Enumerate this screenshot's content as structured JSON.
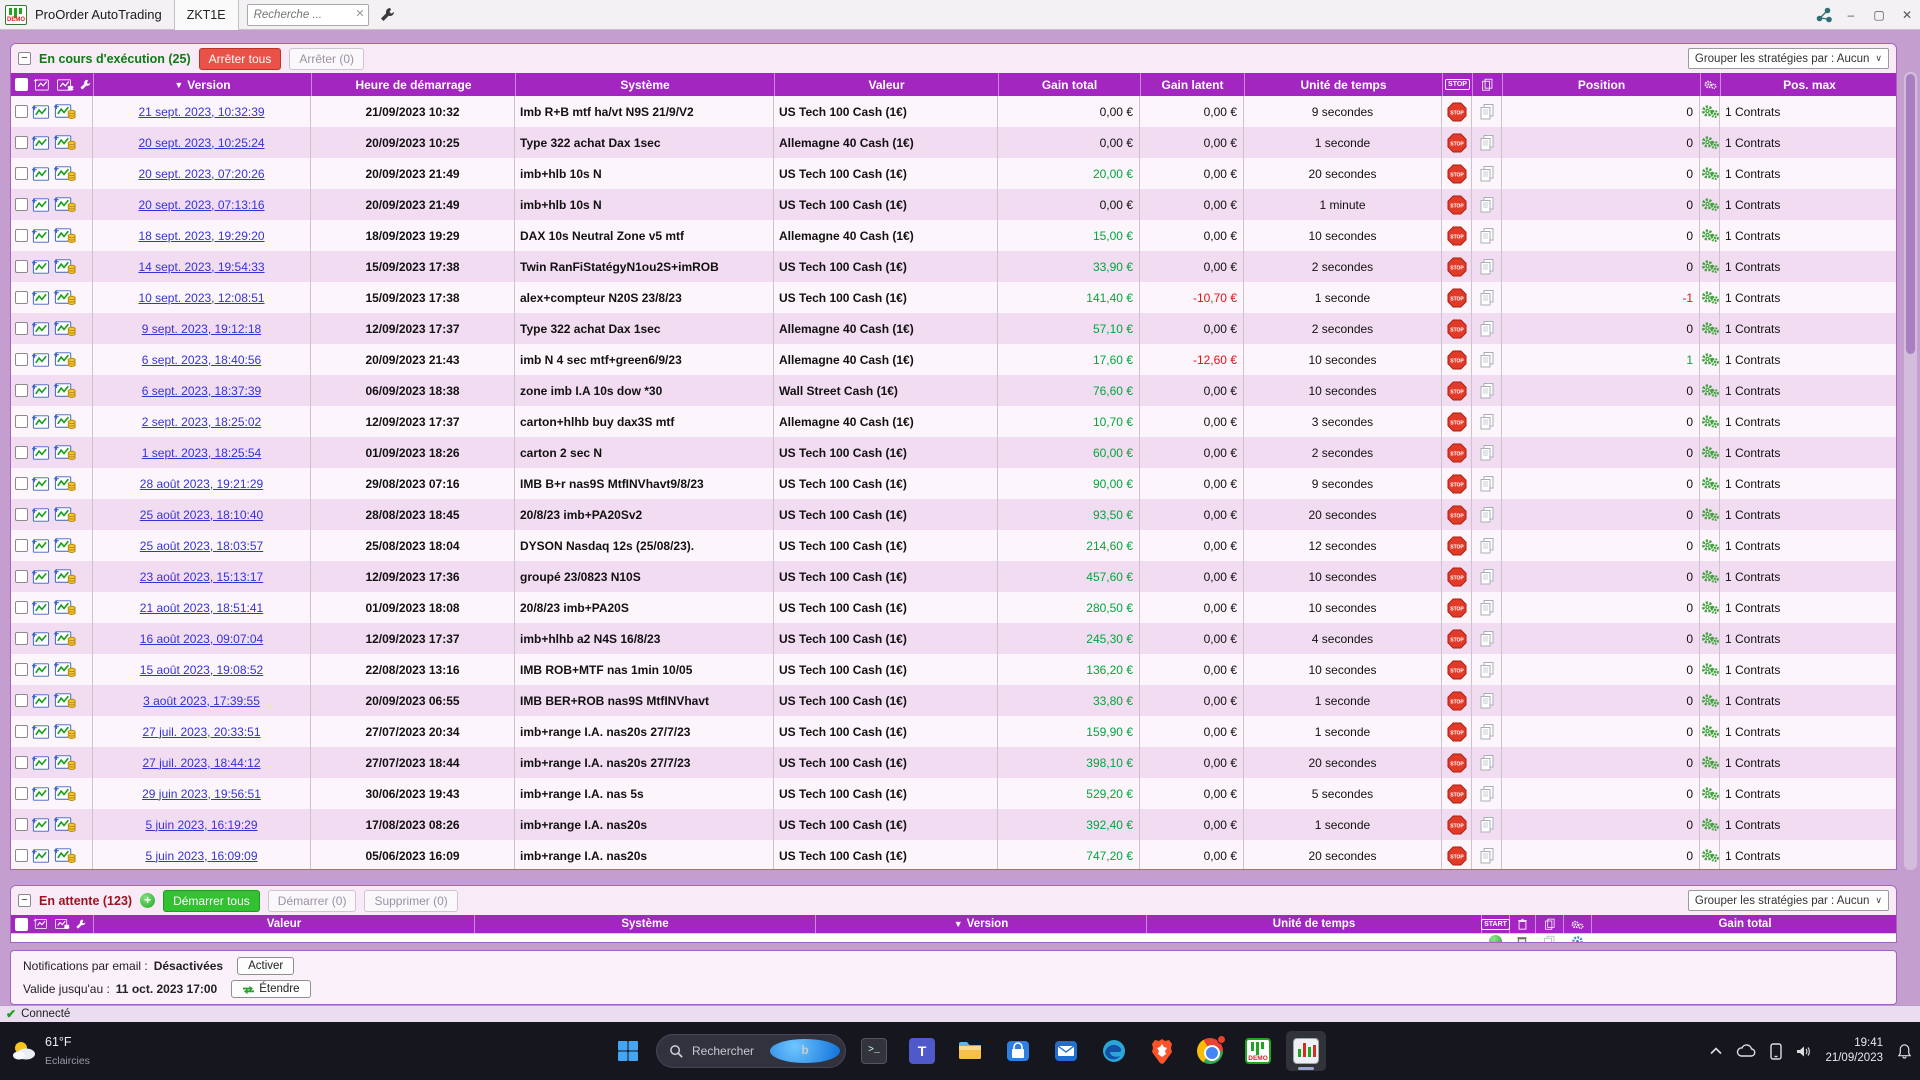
{
  "titlebar": {
    "app_title": "ProOrder AutoTrading",
    "demo_label": "DEMO",
    "tab": "ZKT1E",
    "search_placeholder": "Recherche ..."
  },
  "window_controls": {
    "minimize": "–",
    "maximize": "▢",
    "close": "✕"
  },
  "icons": {
    "collapse": "−",
    "plus": "+",
    "sort_desc": "▼",
    "dropdown_arrow": "∨",
    "clear_search": "✕",
    "check": "✔",
    "chevron_up": "^",
    "stop_badge": "STOP",
    "start_badge": "START"
  },
  "running": {
    "title": "En cours d'exécution (25)",
    "stop_all": "Arrêter tous",
    "stop_selected": "Arrêter (0)",
    "group_by": "Grouper les stratégies par : Aucun",
    "columns": {
      "version": "Version",
      "start": "Heure de démarrage",
      "system": "Système",
      "value": "Valeur",
      "gain": "Gain total",
      "latent": "Gain latent",
      "unit": "Unité de temps",
      "position": "Position",
      "posmax": "Pos. max"
    },
    "rows": [
      {
        "version": "21 sept. 2023, 10:32:39",
        "start": "21/09/2023 10:32",
        "system": "Imb R+B mtf ha/vt N9S 21/9/V2",
        "value": "US Tech 100 Cash (1€)",
        "gain": "0,00 €",
        "latent": "0,00 €",
        "unit": "9 secondes",
        "pos": "0",
        "posmax": "1 Contrats"
      },
      {
        "version": "20 sept. 2023, 10:25:24",
        "start": "20/09/2023 10:25",
        "system": "Type 322 achat Dax 1sec",
        "value": "Allemagne 40 Cash (1€)",
        "gain": "0,00 €",
        "latent": "0,00 €",
        "unit": "1 seconde",
        "pos": "0",
        "posmax": "1 Contrats"
      },
      {
        "version": "20 sept. 2023, 07:20:26",
        "start": "20/09/2023 21:49",
        "system": "imb+hlb 10s N",
        "value": "US Tech 100 Cash (1€)",
        "gain": "20,00 €",
        "latent": "0,00 €",
        "unit": "20 secondes",
        "pos": "0",
        "posmax": "1 Contrats"
      },
      {
        "version": "20 sept. 2023, 07:13:16",
        "start": "20/09/2023 21:49",
        "system": "imb+hlb 10s N",
        "value": "US Tech 100 Cash (1€)",
        "gain": "0,00 €",
        "latent": "0,00 €",
        "unit": "1 minute",
        "pos": "0",
        "posmax": "1 Contrats"
      },
      {
        "version": "18 sept. 2023, 19:29:20",
        "start": "18/09/2023 19:29",
        "system": "DAX 10s Neutral Zone v5 mtf",
        "value": "Allemagne 40 Cash (1€)",
        "gain": "15,00 €",
        "latent": "0,00 €",
        "unit": "10 secondes",
        "pos": "0",
        "posmax": "1 Contrats"
      },
      {
        "version": "14 sept. 2023, 19:54:33",
        "start": "15/09/2023 17:38",
        "system": "Twin RanFiStatégyN1ou2S+imROB",
        "value": "US Tech 100 Cash (1€)",
        "gain": "33,90 €",
        "latent": "0,00 €",
        "unit": "2 secondes",
        "pos": "0",
        "posmax": "1 Contrats"
      },
      {
        "version": "10 sept. 2023, 12:08:51",
        "start": "15/09/2023 17:38",
        "system": "alex+compteur N20S 23/8/23",
        "value": "US Tech 100 Cash (1€)",
        "gain": "141,40 €",
        "latent": "-10,70 €",
        "unit": "1 seconde",
        "pos": "-1",
        "posmax": "1 Contrats"
      },
      {
        "version": "9 sept. 2023, 19:12:18",
        "start": "12/09/2023 17:37",
        "system": "Type 322 achat Dax 1sec",
        "value": "Allemagne 40 Cash (1€)",
        "gain": "57,10 €",
        "latent": "0,00 €",
        "unit": "2 secondes",
        "pos": "0",
        "posmax": "1 Contrats"
      },
      {
        "version": "6 sept. 2023, 18:40:56",
        "start": "20/09/2023 21:43",
        "system": "imb N 4 sec mtf+green6/9/23",
        "value": "Allemagne 40 Cash (1€)",
        "gain": "17,60 €",
        "latent": "-12,60 €",
        "unit": "10 secondes",
        "pos": "1",
        "posmax": "1 Contrats"
      },
      {
        "version": "6 sept. 2023, 18:37:39",
        "start": "06/09/2023 18:38",
        "system": "zone imb I.A 10s dow *30",
        "value": "Wall Street Cash (1€)",
        "gain": "76,60 €",
        "latent": "0,00 €",
        "unit": "10 secondes",
        "pos": "0",
        "posmax": "1 Contrats"
      },
      {
        "version": "2 sept. 2023, 18:25:02",
        "start": "12/09/2023 17:37",
        "system": "carton+hlhb buy dax3S mtf",
        "value": "Allemagne 40 Cash (1€)",
        "gain": "10,70 €",
        "latent": "0,00 €",
        "unit": "3 secondes",
        "pos": "0",
        "posmax": "1 Contrats"
      },
      {
        "version": "1 sept. 2023, 18:25:54",
        "start": "01/09/2023 18:26",
        "system": "carton 2 sec N",
        "value": "US Tech 100 Cash (1€)",
        "gain": "60,00 €",
        "latent": "0,00 €",
        "unit": "2 secondes",
        "pos": "0",
        "posmax": "1 Contrats"
      },
      {
        "version": "28 août 2023, 19:21:29",
        "start": "29/08/2023 07:16",
        "system": "IMB B+r nas9S MtfINVhavt9/8/23",
        "value": "US Tech 100 Cash (1€)",
        "gain": "90,00 €",
        "latent": "0,00 €",
        "unit": "9 secondes",
        "pos": "0",
        "posmax": "1 Contrats"
      },
      {
        "version": "25 août 2023, 18:10:40",
        "start": "28/08/2023 18:45",
        "system": "20/8/23 imb+PA20Sv2",
        "value": "US Tech 100 Cash (1€)",
        "gain": "93,50 €",
        "latent": "0,00 €",
        "unit": "20 secondes",
        "pos": "0",
        "posmax": "1 Contrats"
      },
      {
        "version": "25 août 2023, 18:03:57",
        "start": "25/08/2023 18:04",
        "system": "DYSON Nasdaq 12s (25/08/23).",
        "value": "US Tech 100 Cash (1€)",
        "gain": "214,60 €",
        "latent": "0,00 €",
        "unit": "12 secondes",
        "pos": "0",
        "posmax": "1 Contrats"
      },
      {
        "version": "23 août 2023, 15:13:17",
        "start": "12/09/2023 17:36",
        "system": "groupé 23/0823 N10S",
        "value": "US Tech 100 Cash (1€)",
        "gain": "457,60 €",
        "latent": "0,00 €",
        "unit": "10 secondes",
        "pos": "0",
        "posmax": "1 Contrats"
      },
      {
        "version": "21 août 2023, 18:51:41",
        "start": "01/09/2023 18:08",
        "system": "20/8/23 imb+PA20S",
        "value": "US Tech 100 Cash (1€)",
        "gain": "280,50 €",
        "latent": "0,00 €",
        "unit": "10 secondes",
        "pos": "0",
        "posmax": "1 Contrats"
      },
      {
        "version": "16 août 2023, 09:07:04",
        "start": "12/09/2023 17:37",
        "system": "imb+hlhb a2 N4S 16/8/23",
        "value": "US Tech 100 Cash (1€)",
        "gain": "245,30 €",
        "latent": "0,00 €",
        "unit": "4 secondes",
        "pos": "0",
        "posmax": "1 Contrats"
      },
      {
        "version": "15 août 2023, 19:08:52",
        "start": "22/08/2023 13:16",
        "system": "IMB ROB+MTF nas 1min 10/05",
        "value": "US Tech 100 Cash (1€)",
        "gain": "136,20 €",
        "latent": "0,00 €",
        "unit": "10 secondes",
        "pos": "0",
        "posmax": "1 Contrats"
      },
      {
        "version": "3 août 2023, 17:39:55",
        "start": "20/09/2023 06:55",
        "system": "IMB BER+ROB nas9S MtfINVhavt",
        "value": "US Tech 100 Cash (1€)",
        "gain": "33,80 €",
        "latent": "0,00 €",
        "unit": "1 seconde",
        "pos": "0",
        "posmax": "1 Contrats"
      },
      {
        "version": "27 juil. 2023, 20:33:51",
        "start": "27/07/2023 20:34",
        "system": "imb+range I.A. nas20s 27/7/23",
        "value": "US Tech 100 Cash (1€)",
        "gain": "159,90 €",
        "latent": "0,00 €",
        "unit": "1 seconde",
        "pos": "0",
        "posmax": "1 Contrats"
      },
      {
        "version": "27 juil. 2023, 18:44:12",
        "start": "27/07/2023 18:44",
        "system": "imb+range I.A. nas20s 27/7/23",
        "value": "US Tech 100 Cash (1€)",
        "gain": "398,10 €",
        "latent": "0,00 €",
        "unit": "20 secondes",
        "pos": "0",
        "posmax": "1 Contrats"
      },
      {
        "version": "29 juin 2023, 19:56:51",
        "start": "30/06/2023 19:43",
        "system": "imb+range I.A. nas 5s",
        "value": "US Tech 100 Cash (1€)",
        "gain": "529,20 €",
        "latent": "0,00 €",
        "unit": "5 secondes",
        "pos": "0",
        "posmax": "1 Contrats"
      },
      {
        "version": "5 juin 2023, 16:19:29",
        "start": "17/08/2023 08:26",
        "system": "imb+range I.A. nas20s",
        "value": "US Tech 100 Cash (1€)",
        "gain": "392,40 €",
        "latent": "0,00 €",
        "unit": "1 seconde",
        "pos": "0",
        "posmax": "1 Contrats"
      },
      {
        "version": "5 juin 2023, 16:09:09",
        "start": "05/06/2023 16:09",
        "system": "imb+range I.A. nas20s",
        "value": "US Tech 100 Cash (1€)",
        "gain": "747,20 €",
        "latent": "0,00 €",
        "unit": "20 secondes",
        "pos": "0",
        "posmax": "1 Contrats"
      }
    ]
  },
  "waiting": {
    "title": "En attente (123)",
    "start_all": "Démarrer tous",
    "start_selected": "Démarrer (0)",
    "delete_selected": "Supprimer (0)",
    "group_by": "Grouper les stratégies par : Aucun",
    "columns": {
      "value": "Valeur",
      "system": "Système",
      "version": "Version",
      "unit": "Unité de temps",
      "gain": "Gain total"
    }
  },
  "notifications": {
    "email_label": "Notifications par email :",
    "email_status": "Désactivées",
    "activate": "Activer",
    "valid_label": "Valide jusqu'au :",
    "valid_value": "11 oct. 2023 17:00",
    "extend": "Étendre"
  },
  "statusbar": {
    "connected": "Connecté"
  },
  "taskbar": {
    "weather_temp": "61°F",
    "weather_cond": "Eclaircies",
    "search": "Rechercher",
    "time": "19:41",
    "date": "21/09/2023"
  },
  "colors": {
    "header_purple": "#a426c1",
    "window_mauve": "#c49ecf",
    "link_blue": "#3434d4",
    "gain_green": "#00a63c",
    "loss_red": "#e01414",
    "running_green": "#0c7c14",
    "waiting_red": "#9e1322",
    "stop_red": "#e23a28",
    "start_green": "#31c131"
  }
}
